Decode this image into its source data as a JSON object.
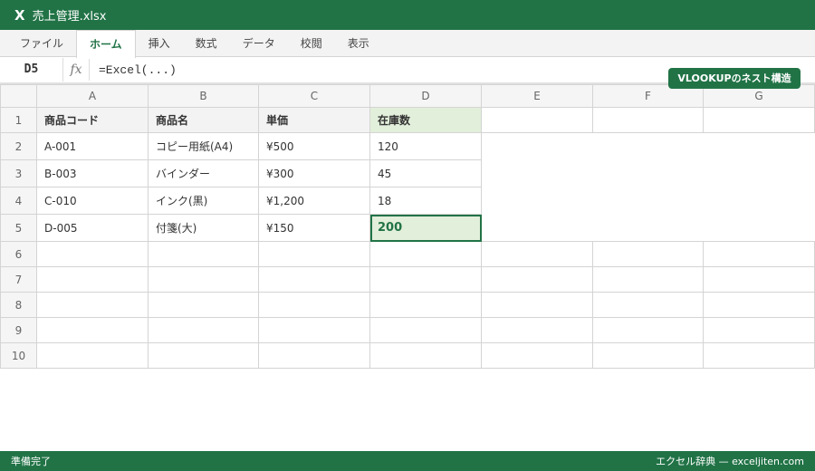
{
  "title": {
    "app_icon": "X",
    "filename": "売上管理.xlsx"
  },
  "ribbon": {
    "tabs": [
      "ファイル",
      "ホーム",
      "挿入",
      "数式",
      "データ",
      "校閲",
      "表示"
    ],
    "active": "ホーム"
  },
  "formula_bar": {
    "name_box": "D5",
    "fx": "fx",
    "formula": "=Excel(...)"
  },
  "badge": "VLOOKUPのネスト構造",
  "sheet": {
    "columns": [
      "A",
      "B",
      "C",
      "D",
      "E",
      "F",
      "G"
    ],
    "row_numbers": [
      "1",
      "2",
      "3",
      "4",
      "5",
      "6",
      "7",
      "8",
      "9",
      "10"
    ],
    "header": [
      "商品コード",
      "商品名",
      "単価",
      "在庫数"
    ],
    "rows": [
      [
        "A-001",
        "コピー用紙(A4)",
        "¥500",
        "120"
      ],
      [
        "B-003",
        "バインダー",
        "¥300",
        "45"
      ],
      [
        "C-010",
        "インク(黒)",
        "¥1,200",
        "18"
      ],
      [
        "D-005",
        "付箋(大)",
        "¥150",
        "200"
      ]
    ],
    "selected_cell": "D5"
  },
  "status": {
    "left": "準備完了",
    "right": "エクセル辞典 — exceljiten.com"
  },
  "colors": {
    "accent": "#217346",
    "selection_fill": "#e2efda"
  }
}
